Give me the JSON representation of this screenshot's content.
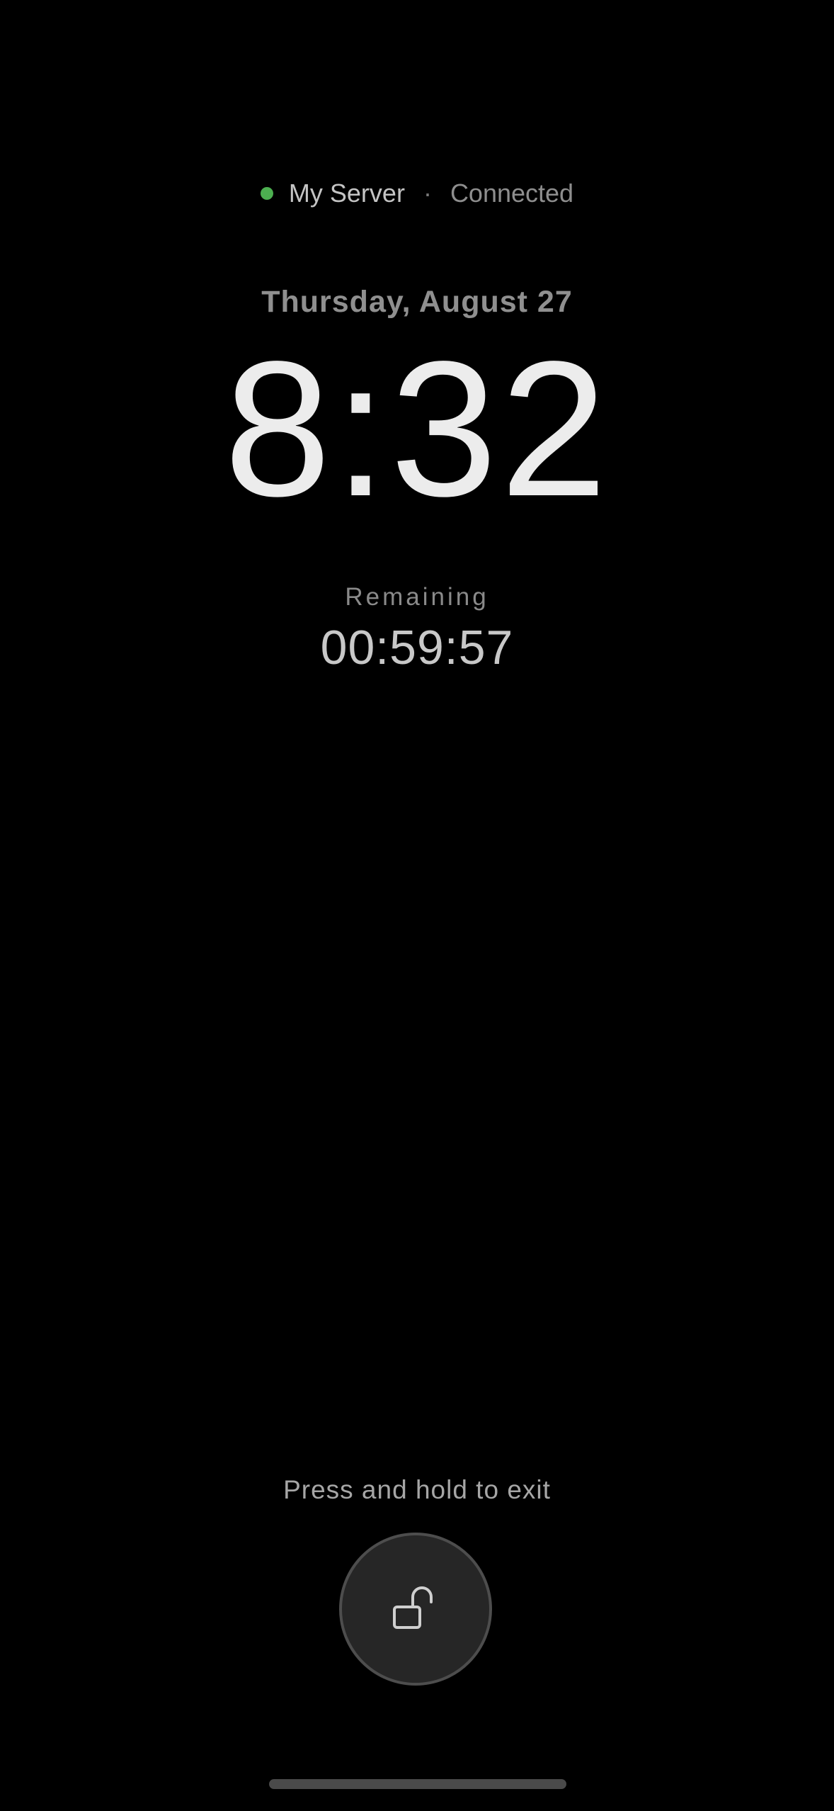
{
  "status": {
    "server_name": "My Server",
    "separator": "·",
    "connection": "Connected",
    "indicator_color": "#4caf50"
  },
  "lock_screen": {
    "date": "Thursday, August 27",
    "time": "8:32",
    "remaining_label": "Remaining",
    "remaining_value": "00:59:57"
  },
  "exit": {
    "hint": "Press and hold to exit",
    "icon": "unlock-icon"
  }
}
